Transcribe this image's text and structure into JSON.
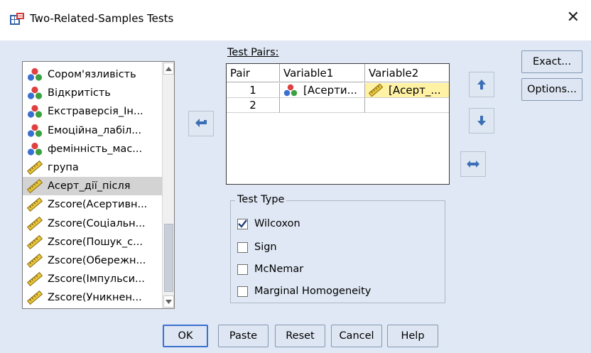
{
  "window": {
    "title": "Two-Related-Samples Tests",
    "close_glyph": "✕"
  },
  "variables": {
    "items": [
      {
        "label": "Сором'язливість",
        "type": "nominal"
      },
      {
        "label": "Відкритість",
        "type": "nominal"
      },
      {
        "label": "Екстраверсія_Ін...",
        "type": "nominal"
      },
      {
        "label": "Емоційна_лабіл...",
        "type": "nominal"
      },
      {
        "label": "фемінність_мас...",
        "type": "nominal"
      },
      {
        "label": "група",
        "type": "scale"
      },
      {
        "label": "Асерт_дії_після",
        "type": "scale",
        "selected": true
      },
      {
        "label": "Zscore(Асертивн...",
        "type": "scale"
      },
      {
        "label": "Zscore(Соціальн...",
        "type": "scale"
      },
      {
        "label": "Zscore(Пошук_с...",
        "type": "scale"
      },
      {
        "label": "Zscore(Обережн...",
        "type": "scale"
      },
      {
        "label": "Zscore(Імпульси...",
        "type": "scale"
      },
      {
        "label": "Zscore(Уникнен...",
        "type": "scale"
      }
    ]
  },
  "test_pairs": {
    "label": "Test Pairs:",
    "columns": [
      "Pair",
      "Variable1",
      "Variable2"
    ],
    "rows": [
      {
        "pair": "1",
        "var1": "[Асерти...",
        "var2": "[Асерт_..."
      },
      {
        "pair": "2",
        "var1": "",
        "var2": ""
      }
    ]
  },
  "side_buttons": {
    "exact": "Exact...",
    "options": "Options..."
  },
  "test_type": {
    "legend": "Test Type",
    "options": [
      {
        "label": "Wilcoxon",
        "checked": true
      },
      {
        "label": "Sign",
        "checked": false
      },
      {
        "label": "McNemar",
        "checked": false
      },
      {
        "label": "Marginal Homogeneity",
        "checked": false
      }
    ]
  },
  "bottom_buttons": {
    "ok": "OK",
    "paste": "Paste",
    "reset": "Reset",
    "cancel": "Cancel",
    "help": "Help"
  },
  "colors": {
    "background": "#dfe8f4",
    "selected_cell": "#fff2a5",
    "arrow_blue": "#3b6fb5",
    "focus_border": "#3a6fd0"
  }
}
